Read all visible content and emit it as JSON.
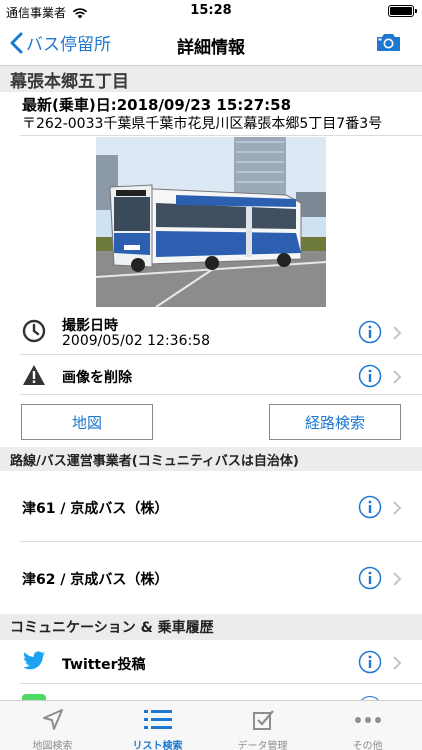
{
  "status_bar": {
    "carrier": "通信事業者",
    "time": "15:28"
  },
  "navbar": {
    "back_label": "バス停留所",
    "title": "詳細情報",
    "camera_icon": "camera-icon"
  },
  "stop": {
    "name": "幕張本郷五丁目",
    "ride_text": "最新(乗車)日:2018/09/23 15:27:58",
    "address": "〒262-0033千葉県千葉市花見川区幕張本郷5丁目7番3号"
  },
  "photo_rows": [
    {
      "title": "撮影日時",
      "subtitle": "2009/05/02 12:36:58",
      "icon": "clock-icon"
    },
    {
      "title": "画像を削除",
      "icon": "warning-icon"
    }
  ],
  "buttons": {
    "map": "地図",
    "route": "経路検索"
  },
  "operators_header": "路線/バス運営事業者(コミュニティバスは自治体)",
  "operators": [
    {
      "label": "津61 / 京成バス（株）"
    },
    {
      "label": "津62 / 京成バス（株）"
    }
  ],
  "comm_header": "コミュニケーション & 乗車履歴",
  "comm_rows": [
    {
      "label": "Twitter投稿",
      "icon": "twitter-icon"
    }
  ],
  "tabs": [
    {
      "label": "地図検索",
      "icon": "location-arrow-icon",
      "active": false
    },
    {
      "label": "リスト検索",
      "icon": "list-icon",
      "active": true
    },
    {
      "label": "データ管理",
      "icon": "checkbox-icon",
      "active": false
    },
    {
      "label": "その他",
      "icon": "more-icon",
      "active": false
    }
  ],
  "colors": {
    "accent": "#1e78d2",
    "twitter": "#1da1f2",
    "section_bg": "#ececec"
  }
}
